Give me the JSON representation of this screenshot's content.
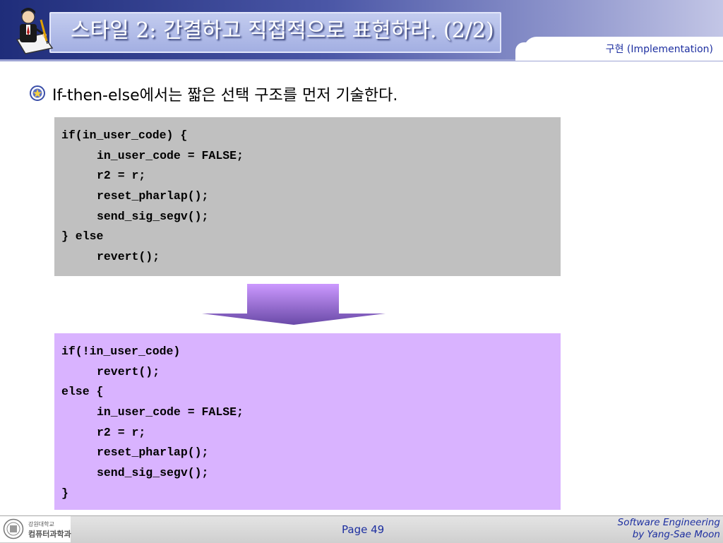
{
  "slide": {
    "title": "스타일 2: 간결하고 직접적으로 표현하라. (2/2)",
    "subtitle": "구현 (Implementation)",
    "bullet": "If-then-else에서는 짧은 선택 구조를 먼저 기술한다."
  },
  "code_before": {
    "lines": [
      {
        "text": "if(in_user_code) {",
        "indent": false
      },
      {
        "text": "in_user_code = FALSE;",
        "indent": true
      },
      {
        "text": "r2 = r;",
        "indent": true
      },
      {
        "text": "reset_pharlap();",
        "indent": true
      },
      {
        "text": "send_sig_segv();",
        "indent": true
      },
      {
        "text": "} else",
        "indent": false
      },
      {
        "text": "revert();",
        "indent": true
      }
    ]
  },
  "code_after": {
    "lines": [
      {
        "text": "if(!in_user_code)",
        "indent": false
      },
      {
        "text": "revert();",
        "indent": true
      },
      {
        "text": "else {",
        "indent": false
      },
      {
        "text": "in_user_code = FALSE;",
        "indent": true
      },
      {
        "text": "r2 = r;",
        "indent": true
      },
      {
        "text": "reset_pharlap();",
        "indent": true
      },
      {
        "text": "send_sig_segv();",
        "indent": true
      },
      {
        "text": "}",
        "indent": false
      }
    ]
  },
  "footer": {
    "dept_line1": "강원대학교",
    "dept_line2": "컴퓨터과학과",
    "page": "Page 49",
    "credit_line1": "Software Engineering",
    "credit_line2": "by Yang-Sae Moon"
  },
  "colors": {
    "header_dark": "#1f2d7a",
    "accent_text": "#1d2fa0",
    "code_before_bg": "#c0c0c0",
    "code_after_bg": "#d9b3ff",
    "arrow_top": "#cc99ff",
    "arrow_bottom": "#6a4aa8"
  }
}
